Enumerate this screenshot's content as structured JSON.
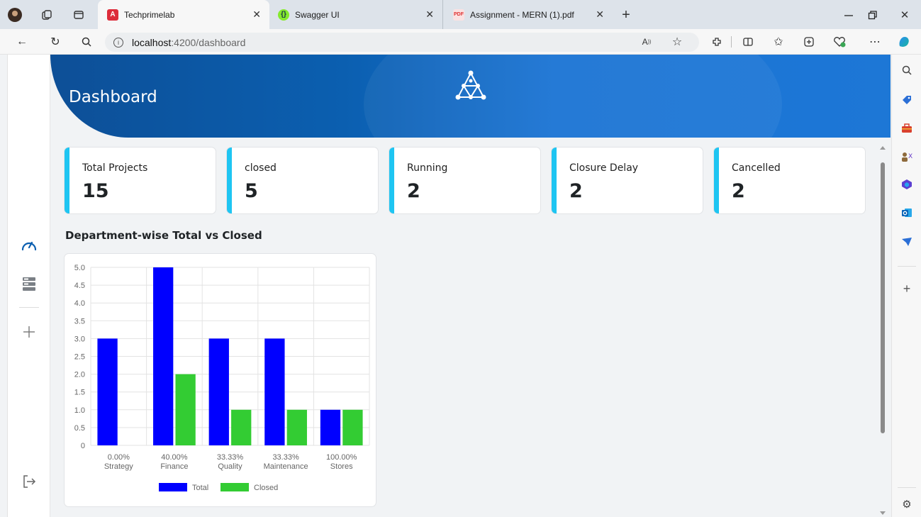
{
  "browser": {
    "tabs": [
      {
        "title": "Techprimelab",
        "active": true
      },
      {
        "title": "Swagger UI",
        "active": false
      },
      {
        "title": "Assignment - MERN (1).pdf",
        "active": false
      }
    ],
    "address": {
      "host": "localhost",
      "path": ":4200/dashboard"
    }
  },
  "header": {
    "title": "Dashboard"
  },
  "stats": [
    {
      "label": "Total Projects",
      "value": "15"
    },
    {
      "label": "closed",
      "value": "5"
    },
    {
      "label": "Running",
      "value": "2"
    },
    {
      "label": "Closure Delay",
      "value": "2"
    },
    {
      "label": "Cancelled",
      "value": "2"
    }
  ],
  "chart_section": {
    "title": "Department-wise Total vs Closed"
  },
  "chart_data": {
    "type": "bar",
    "categories": [
      "Strategy",
      "Finance",
      "Quality",
      "Maintenance",
      "Stores"
    ],
    "category_percent": [
      "0.00%",
      "40.00%",
      "33.33%",
      "33.33%",
      "100.00%"
    ],
    "series": [
      {
        "name": "Total",
        "color": "#0000ff",
        "values": [
          3,
          5,
          3,
          3,
          1
        ]
      },
      {
        "name": "Closed",
        "color": "#33cc33",
        "values": [
          0,
          2,
          1,
          1,
          1
        ]
      }
    ],
    "yticks": [
      "0",
      "0.5",
      "1.0",
      "1.5",
      "2.0",
      "2.5",
      "3.0",
      "3.5",
      "4.0",
      "4.5",
      "5.0"
    ],
    "ylim": [
      0,
      5
    ],
    "grid": true,
    "legend": "bottom"
  },
  "colors": {
    "accent": "#1ec5f2",
    "header": "#0b5fb0"
  }
}
